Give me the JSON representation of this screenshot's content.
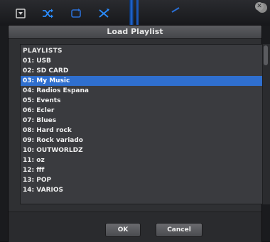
{
  "topbar": {
    "icons": [
      "dropdown-box-icon",
      "shuffle-icon",
      "repeat-icon",
      "crossfade-icon"
    ]
  },
  "dialog": {
    "title": "Load Playlist",
    "list_header": "PLAYLISTS",
    "items": [
      {
        "label": "01: USB"
      },
      {
        "label": "02: SD CARD"
      },
      {
        "label": "03: My Music",
        "selected": true
      },
      {
        "label": "04: Radios Espana"
      },
      {
        "label": "05: Events"
      },
      {
        "label": "06: Ecler"
      },
      {
        "label": "07: Blues"
      },
      {
        "label": "08: Hard rock"
      },
      {
        "label": "09: Rock variado"
      },
      {
        "label": "10: OUTWORLDZ"
      },
      {
        "label": "11: oz"
      },
      {
        "label": "12: fff"
      },
      {
        "label": "13: POP"
      },
      {
        "label": "14: VARIOS"
      }
    ],
    "ok_label": "OK",
    "cancel_label": "Cancel"
  },
  "colors": {
    "selection": "#2f6fcf",
    "accent_blue": "#1f6be0",
    "background": "#121316"
  }
}
